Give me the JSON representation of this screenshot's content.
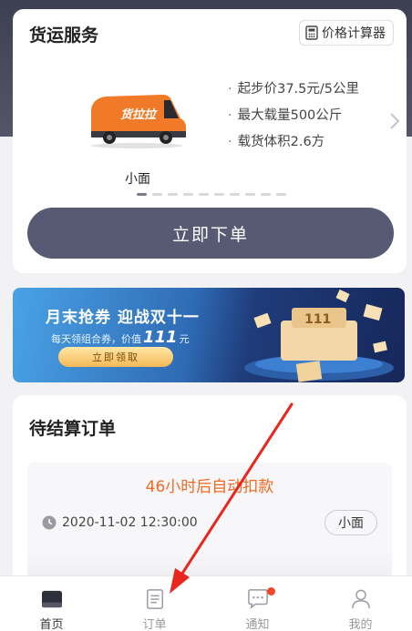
{
  "freight": {
    "title": "货运服务",
    "calculator_label": "价格计算器",
    "vehicle_name": "小面",
    "van_brand": "货拉拉",
    "specs": [
      "起步价37.5元/5公里",
      "最大载量500公斤",
      "载货体积2.6方"
    ],
    "carousel_total": 10,
    "carousel_active": 0,
    "order_button": "立即下单"
  },
  "banner": {
    "title": "月末抢券  迎战双十一",
    "subtitle_prefix": "每天领组合券，价值",
    "amount": "111",
    "unit": "元",
    "claim_button": "立即领取",
    "art_number": "111"
  },
  "pending": {
    "title": "待结算订单",
    "countdown": "46小时后自动扣款",
    "time": "2020-11-02 12:30:00",
    "vehicle": "小面"
  },
  "tabs": [
    {
      "label": "首页",
      "icon": "home-icon",
      "active": true
    },
    {
      "label": "订单",
      "icon": "order-list-icon",
      "active": false
    },
    {
      "label": "通知",
      "icon": "message-icon",
      "active": false,
      "badge": true
    },
    {
      "label": "我的",
      "icon": "profile-icon",
      "active": false
    }
  ],
  "colors": {
    "primary_button": "#585a73",
    "van_orange": "#f07a28",
    "countdown": "#f06a21",
    "annotation_arrow": "#e8261e"
  }
}
